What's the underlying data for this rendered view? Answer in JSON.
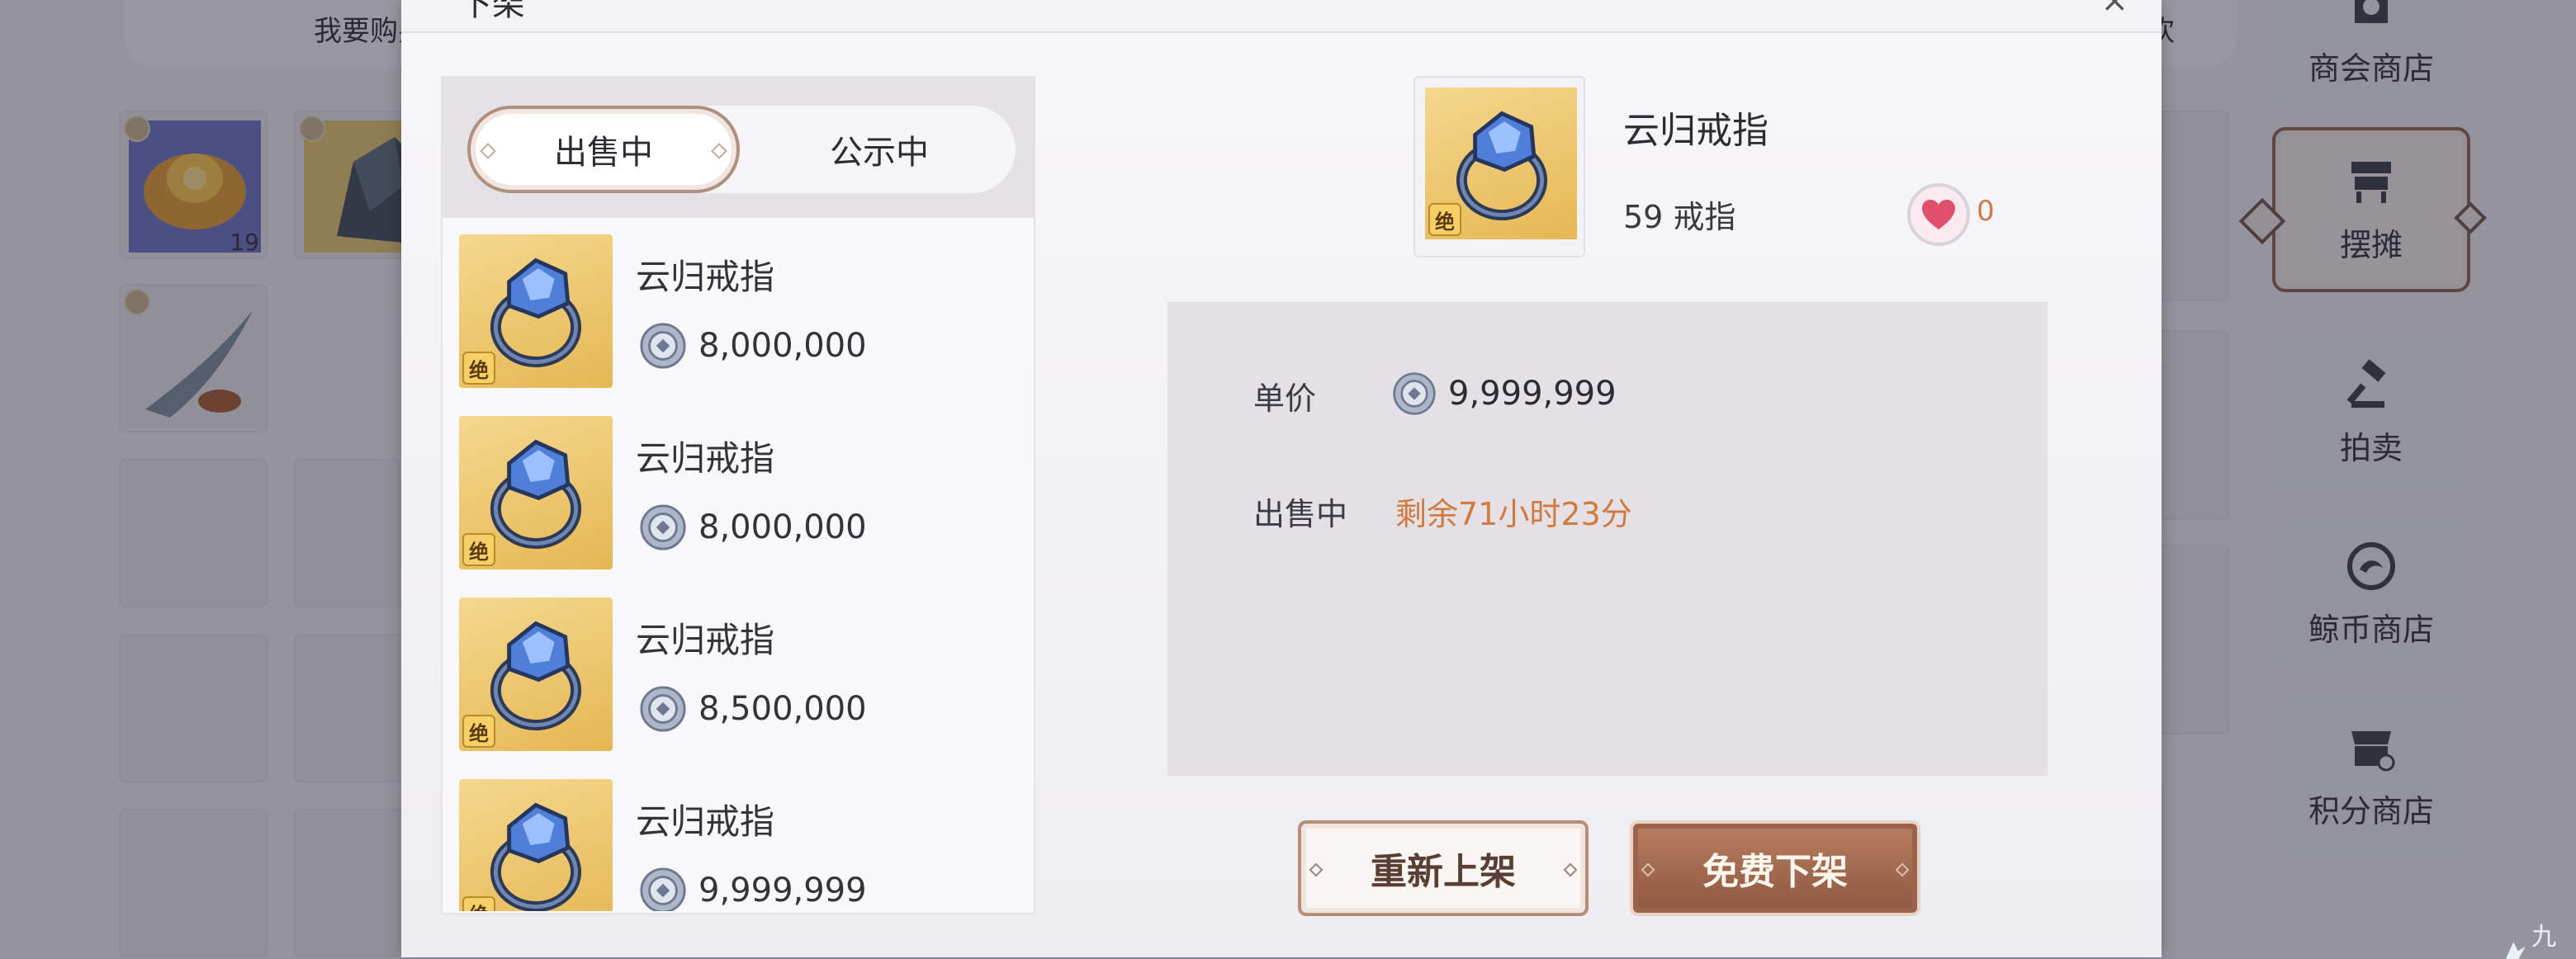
{
  "background": {
    "tabs": [
      "我要购买"
    ],
    "right_fragment": "欢",
    "inventory": [
      {
        "name": "gold-coin-pile-item",
        "count": "19"
      },
      {
        "name": "dark-ore-item",
        "count": ""
      },
      {
        "name": "fish-item",
        "count": ""
      }
    ],
    "nav": [
      {
        "label": "商会商店",
        "icon": "merchant-icon",
        "active": false
      },
      {
        "label": "摆摊",
        "icon": "stall-icon",
        "active": true
      },
      {
        "label": "拍卖",
        "icon": "gavel-icon",
        "active": false
      },
      {
        "label": "鲸币商店",
        "icon": "whale-coin-icon",
        "active": false
      },
      {
        "label": "积分商店",
        "icon": "points-shop-icon",
        "active": false
      }
    ]
  },
  "modal": {
    "title_fragment": "下架",
    "close_fragment": "×",
    "tabs": {
      "active": "出售中",
      "inactive": "公示中"
    },
    "listings": [
      {
        "name": "云归戒指",
        "price": "8,000,000",
        "badge": "绝"
      },
      {
        "name": "云归戒指",
        "price": "8,000,000",
        "badge": "绝"
      },
      {
        "name": "云归戒指",
        "price": "8,500,000",
        "badge": "绝"
      },
      {
        "name": "云归戒指",
        "price": "9,999,999",
        "badge": "绝"
      }
    ],
    "selected": {
      "name": "云归戒指",
      "level_line": "59 戒指",
      "badge": "绝",
      "likes": "0"
    },
    "detail": {
      "unit_price_label": "单价",
      "unit_price": "9,999,999",
      "status_label": "出售中",
      "remaining": "剩余71小时23分"
    },
    "buttons": {
      "relist": "重新上架",
      "free_delist": "免费下架"
    }
  },
  "watermark": "九游",
  "colors": {
    "accent_brown": "#8d5740",
    "remaining_orange": "#d07a40",
    "item_gold": "#e5b753"
  }
}
